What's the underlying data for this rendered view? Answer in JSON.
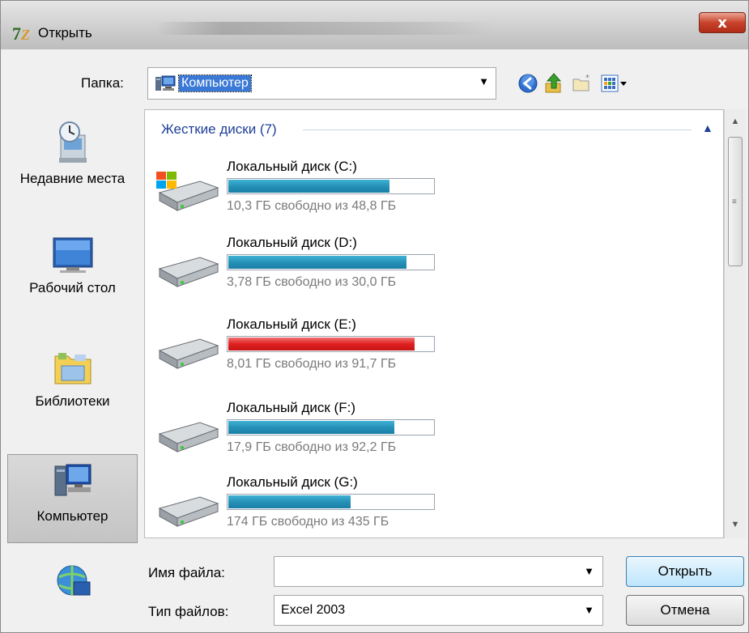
{
  "window": {
    "title": "Открыть"
  },
  "toolbar": {
    "lookin_label": "Папка:",
    "lookin_value": "Компьютер"
  },
  "places": [
    {
      "label": "Недавние места",
      "icon": "recent-places-icon"
    },
    {
      "label": "Рабочий стол",
      "icon": "desktop-icon"
    },
    {
      "label": "Библиотеки",
      "icon": "libraries-icon"
    },
    {
      "label": "Компьютер",
      "icon": "computer-icon"
    },
    {
      "label": "",
      "icon": "network-icon"
    }
  ],
  "list": {
    "group_header": "Жесткие диски (7)",
    "drives": [
      {
        "name": "Локальный диск (C:)",
        "free": "10,3 ГБ свободно из 48,8 ГБ",
        "used_fraction": 0.79,
        "bar_color": "#2691b8",
        "icon": "windows-drive-icon"
      },
      {
        "name": "Локальный диск (D:)",
        "free": "3,78 ГБ свободно из 30,0 ГБ",
        "used_fraction": 0.87,
        "bar_color": "#2691b8",
        "icon": "hard-drive-icon"
      },
      {
        "name": "Локальный диск (E:)",
        "free": "8,01 ГБ свободно из 91,7 ГБ",
        "used_fraction": 0.91,
        "bar_color": "#e02020",
        "icon": "hard-drive-icon"
      },
      {
        "name": "Локальный диск (F:)",
        "free": "17,9 ГБ свободно из 92,2 ГБ",
        "used_fraction": 0.81,
        "bar_color": "#2691b8",
        "icon": "hard-drive-icon"
      },
      {
        "name": "Локальный диск (G:)",
        "free": "174 ГБ свободно из 435 ГБ",
        "used_fraction": 0.6,
        "bar_color": "#2691b8",
        "icon": "hard-drive-icon"
      }
    ]
  },
  "footer": {
    "filename_label": "Имя файла:",
    "filename_value": "",
    "filetype_label": "Тип файлов:",
    "filetype_value": "Excel 2003",
    "open_label": "Открыть",
    "cancel_label": "Отмена"
  }
}
